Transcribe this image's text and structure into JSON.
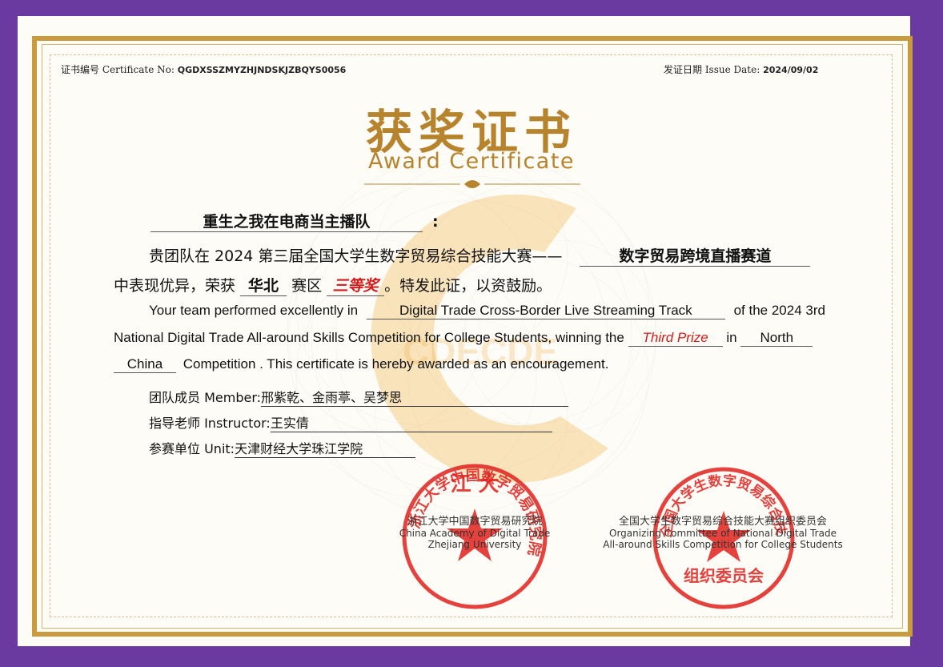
{
  "header": {
    "cert_no_label": "证书编号 Certificate No:",
    "cert_no_value": "QGDXSSZMYZHJNDSKJZBQYS0056",
    "issue_label": "发证日期 Issue Date:",
    "issue_value": "2024/09/02"
  },
  "title": {
    "cn": "获奖证书",
    "en": "Award Certificate"
  },
  "team": {
    "name": "重生之我在电商当主播队",
    "colon": ":"
  },
  "body_cn": {
    "line1_prefix": "贵团队在 2024 第三届全国大学生数字贸易综合技能大赛——",
    "track": "数字贸易跨境直播赛道",
    "line2_prefix": "中表现优异，荣获",
    "region": "华北",
    "region_suffix": "赛区",
    "prize": "三等奖",
    "line2_suffix": "。特发此证，以资鼓励。"
  },
  "body_en": {
    "line1_prefix": "Your team performed excellently in",
    "track": "Digital Trade Cross-Border Live Streaming Track",
    "line1_suffix": "of the 2024 3rd",
    "line2_prefix": "National Digital Trade All-around Skills Competition for College Students, winning the",
    "prize": "Third Prize",
    "in_word": "in",
    "region_a": "North",
    "region_b": "China",
    "line3_suffix": "Competition . This certificate is hereby awarded as an encouragement."
  },
  "members": {
    "label": "团队成员 Member:",
    "value": "邢紫乾、金雨葶、吴梦思"
  },
  "instructor": {
    "label": "指导老师 Instructor:",
    "value": "王实倩"
  },
  "unit": {
    "label": "参赛单位 Unit:",
    "value": "天津财经大学珠江学院"
  },
  "org_left": {
    "cn": "浙江大学中国数字贸易研究院",
    "en1": "China Academy of Digital Trade",
    "en2": "Zhejiang University"
  },
  "org_right": {
    "cn": "全国大学生数字贸易综合技能大赛组织委员会",
    "en1": "Organizing Committee of National Digital Trade",
    "en2": "All-around Skills Competition for College Students"
  },
  "seal_left": {
    "top_text": "江 大",
    "ring_text": "浙江大学中国数字贸易研究院"
  },
  "seal_right": {
    "ring_text": "全国大学生数字贸易综合技能大赛",
    "bottom_text": "组织委员会"
  },
  "watermark": "CDECDE",
  "colors": {
    "gold": "#b7832c",
    "purple_frame": "#6a3aa0",
    "seal_red": "#e0201c",
    "prize_red": "#d21b1b"
  }
}
